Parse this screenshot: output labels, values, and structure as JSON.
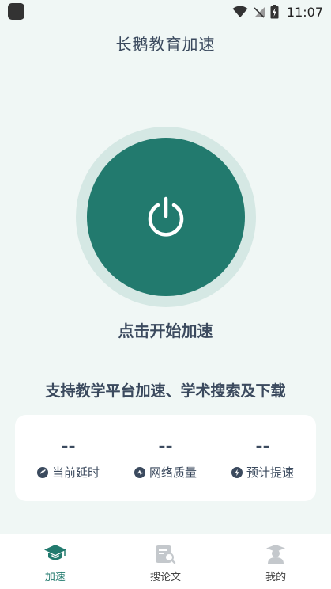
{
  "status_bar": {
    "time": "11:07"
  },
  "header": {
    "title": "长鹅教育加速"
  },
  "main": {
    "start_label": "点击开始加速",
    "tagline": "支持教学平台加速、学术搜索及下载"
  },
  "stats": [
    {
      "value": "--",
      "label": "当前延时",
      "icon": "clock-icon"
    },
    {
      "value": "--",
      "label": "网络质量",
      "icon": "signal-icon"
    },
    {
      "value": "--",
      "label": "预计提速",
      "icon": "boost-icon"
    }
  ],
  "nav": [
    {
      "label": "加速",
      "icon": "graduation-cap-icon",
      "active": true
    },
    {
      "label": "搜论文",
      "icon": "search-document-icon",
      "active": false
    },
    {
      "label": "我的",
      "icon": "profile-icon",
      "active": false
    }
  ],
  "colors": {
    "accent": "#227a6e",
    "ring": "#d5e8e4",
    "background": "#f0f7f5",
    "text": "#3b4a5e",
    "inactive_icon": "#c4c8cc"
  }
}
